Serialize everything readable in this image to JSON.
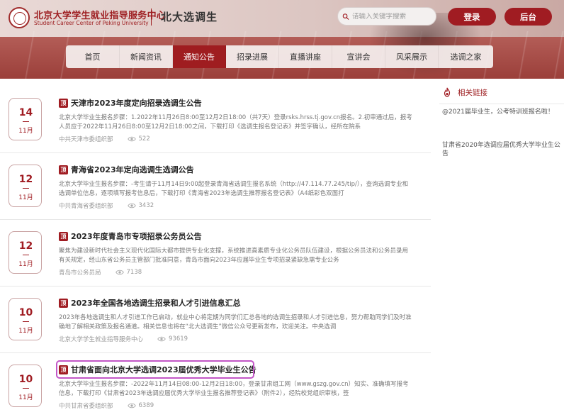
{
  "header": {
    "logo_cn": "北京大学学生就业指导服务中心",
    "logo_en": "Student Career Center of Peking University",
    "site_title": "北大选调生",
    "search_placeholder": "请输入关键字搜索",
    "login_label": "登录",
    "admin_label": "后台"
  },
  "nav": {
    "items": [
      {
        "label": "首页"
      },
      {
        "label": "新闻资讯"
      },
      {
        "label": "通知公告"
      },
      {
        "label": "招录进展"
      },
      {
        "label": "直播讲座"
      },
      {
        "label": "宣讲会"
      },
      {
        "label": "风采展示"
      },
      {
        "label": "选调之家"
      }
    ],
    "active_index": 2
  },
  "articles": [
    {
      "day": "14",
      "month": "11月",
      "tag": "顶",
      "title": "天津市2023年度定向招录选调生公告",
      "summary": "北京大学毕业生报名步骤：1.2022年11月26日8:00至12月2日18:00（共7天）登录rsks.hrss.tj.gov.cn报名。2.初审通过后，报考人员应于2022年11月26日8:00至12月2日18:00之间，下载打印《选调生报名登记表》并签字确认，经所在院系",
      "source": "中共天津市委组织部",
      "views": "522"
    },
    {
      "day": "12",
      "month": "11月",
      "tag": "顶",
      "title": "青海省2023年定向选调生选调公告",
      "summary": "北京大学毕业生报名步骤：-考生请于11月14日9:00起登录青海省选调生报名系统（http://47.114.77.245/tip/），查询选调专业和选调单位信息，逐项填写报考信息后，下载打印《青海省2023年选调生推荐报名登记表》（A4纸彩色双面打",
      "source": "中共青海省委组织部",
      "views": "3432"
    },
    {
      "day": "12",
      "month": "11月",
      "tag": "顶",
      "title": "2023年度青岛市专项招录公务员公告",
      "summary": "聚焦为建设新时代社会主义现代化国际大都市提供专业化支撑，系统推进高素质专业化公务员队伍建设，根据公务员法和公务员录用有关规定，经山东省公务员主管部门批准同意，青岛市面向2023年应届毕业生专项招录紧缺急需专业公务",
      "source": "青岛市公务员局",
      "views": "7138"
    },
    {
      "day": "10",
      "month": "11月",
      "tag": "顶",
      "title": "2023年全国各地选调生招录和人才引进信息汇总",
      "summary": "2023年各地选调生和人才引进工作已启动，就业中心将定期为同学们汇总各地的选调生招录和人才引进信息，努力帮助同学们及时准确地了解相关政策及报名通道。相关信息也将在“北大选调生”微信公众号更新发布，欢迎关注。中央选调",
      "source": "北京大学学生就业指导服务中心",
      "views": "93619"
    },
    {
      "day": "10",
      "month": "11月",
      "tag": "顶",
      "title": "甘肃省面向北京大学选调2023届优秀大学毕业生公告",
      "summary": "北京大学毕业生报名步骤：-2022年11月14日08:00-12月2日18:00，登录甘肃组工网（www.gszg.gov.cn）知实、准确填写报考信息，下载打印《甘肃省2023年选调应届优秀大学毕业生报名推荐登记表》（附件2），经院校党组织审核，签",
      "source": "中共甘肃省委组织部",
      "views": "6389"
    }
  ],
  "sidebar": {
    "heading": "相关链接",
    "links": [
      {
        "label": "@2021届毕业生，公考特训班报名啦！"
      },
      {
        "label": "甘肃省2020年选调应届优秀大学毕业生公告"
      }
    ]
  },
  "colors": {
    "brand_red": "#a01c22",
    "highlight_outline": "#c357c7"
  }
}
